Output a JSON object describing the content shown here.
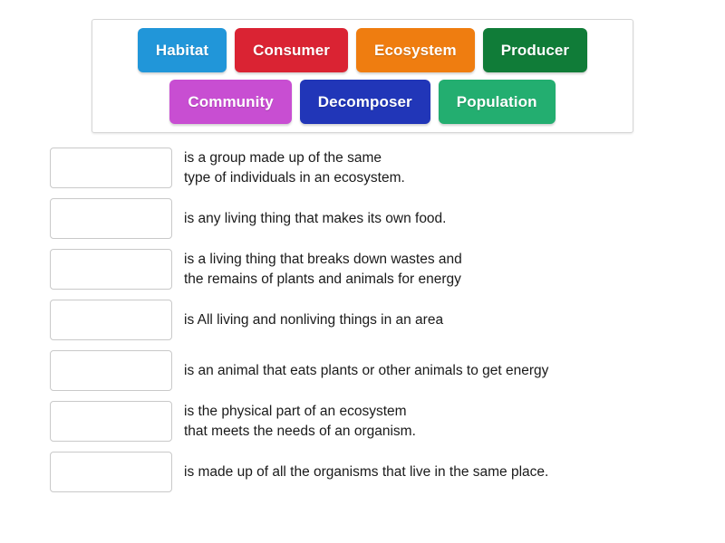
{
  "word_bank": {
    "rows": [
      [
        {
          "label": "Habitat",
          "color": "#2196d9"
        },
        {
          "label": "Consumer",
          "color": "#da2333"
        },
        {
          "label": "Ecosystem",
          "color": "#ef7d10"
        },
        {
          "label": "Producer",
          "color": "#107c38"
        }
      ],
      [
        {
          "label": "Community",
          "color": "#c84ed2"
        },
        {
          "label": "Decomposer",
          "color": "#2136b8"
        },
        {
          "label": "Population",
          "color": "#23ae70"
        }
      ]
    ]
  },
  "definitions": [
    {
      "answer": "",
      "text": "is a group made up of the same\n type of individuals  in an ecosystem."
    },
    {
      "answer": "",
      "text": "is any living thing that makes its own food."
    },
    {
      "answer": "",
      "text": "is a living thing that breaks down wastes and\nthe remains of plants and animals for energy"
    },
    {
      "answer": "",
      "text": "is All living and nonliving things in an area"
    },
    {
      "answer": "",
      "text": "is an animal that eats plants or other animals to get energy"
    },
    {
      "answer": "",
      "text": "is the physical part of an ecosystem\nthat meets the needs of an organism."
    },
    {
      "answer": "",
      "text": "is made up of all the organisms that live in the same place."
    }
  ]
}
